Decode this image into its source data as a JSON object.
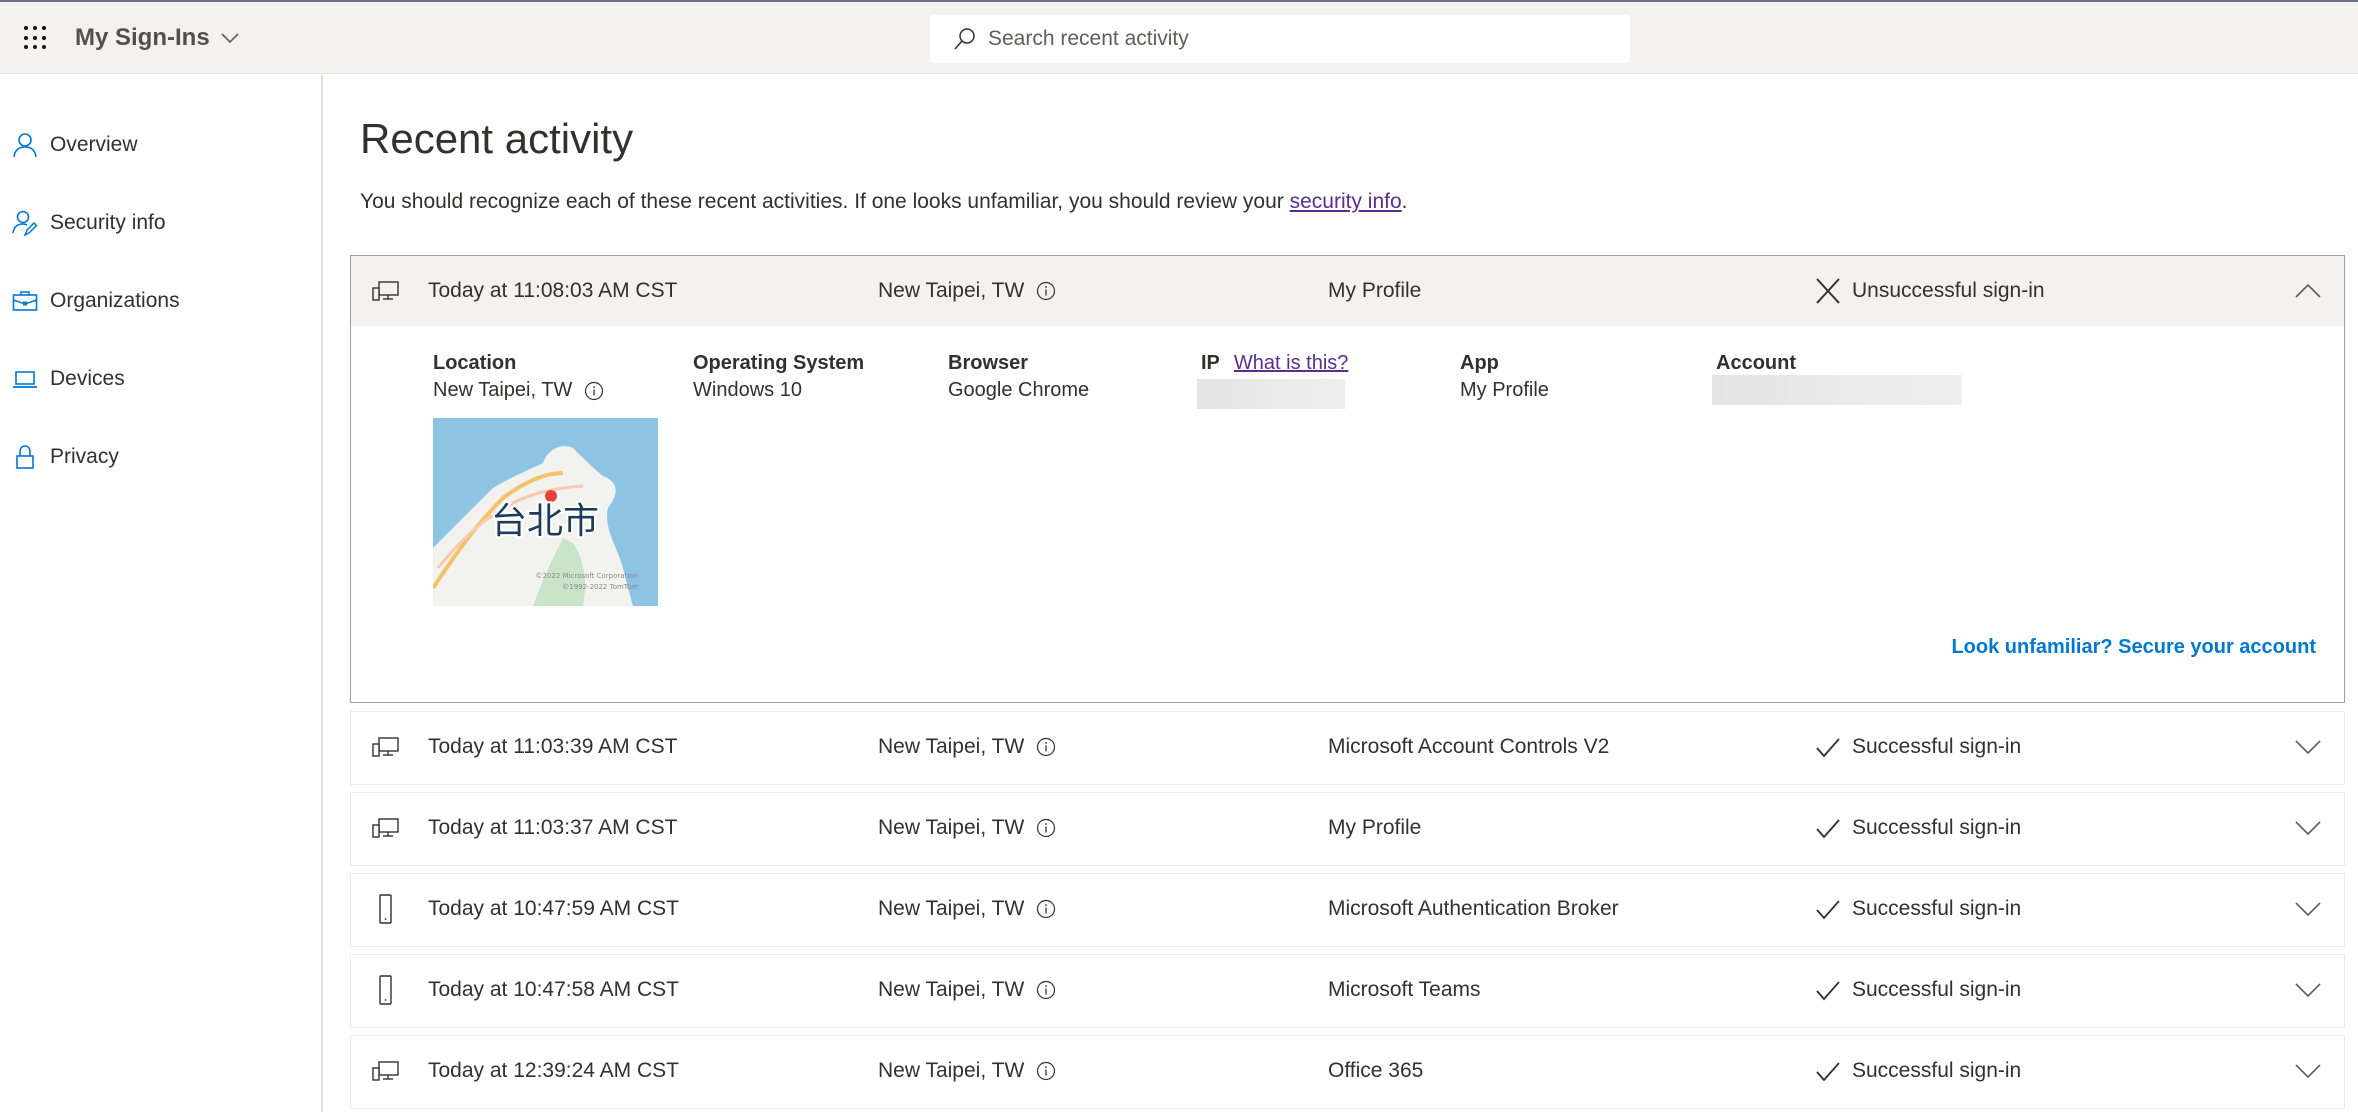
{
  "header": {
    "app_title": "My Sign-Ins",
    "search_placeholder": "Search recent activity",
    "icons": {
      "launcher": "waffle-icon",
      "title_menu": "chevron-down-icon",
      "search": "search-icon"
    }
  },
  "sidebar": {
    "items": [
      {
        "label": "Overview",
        "icon": "person-icon"
      },
      {
        "label": "Security info",
        "icon": "person-edit-icon"
      },
      {
        "label": "Organizations",
        "icon": "briefcase-icon"
      },
      {
        "label": "Devices",
        "icon": "laptop-icon"
      },
      {
        "label": "Privacy",
        "icon": "lock-icon"
      }
    ],
    "accent_color": "#0078d4"
  },
  "main": {
    "title": "Recent activity",
    "subtitle_text": "You should recognize each of these recent activities. If one looks unfamiliar, you should review your ",
    "subtitle_link": "security info",
    "subtitle_end": ".",
    "expanded": {
      "time": "Today at 11:08:03 AM CST",
      "location": "New Taipei, TW",
      "app": "My Profile",
      "status": "Unsuccessful sign-in",
      "device_icon": "desktop-and-phone-icon",
      "details": {
        "location_label": "Location",
        "location_value": "New Taipei, TW",
        "os_label": "Operating System",
        "os_value": "Windows 10",
        "browser_label": "Browser",
        "browser_value": "Google Chrome",
        "ip_label": "IP",
        "ip_help_link": "What is this?",
        "app_label": "App",
        "app_value": "My Profile",
        "account_label": "Account",
        "map_label": "台北市",
        "map_copyright_1": "©2022 Microsoft Corporation",
        "map_copyright_2": "©1992-2022 TomTom"
      },
      "secure_link": "Look unfamiliar? Secure your account"
    },
    "rows": [
      {
        "time": "Today at 11:03:39 AM CST",
        "location": "New Taipei, TW",
        "app": "Microsoft Account Controls V2",
        "status": "Successful sign-in",
        "device": "desktop"
      },
      {
        "time": "Today at 11:03:37 AM CST",
        "location": "New Taipei, TW",
        "app": "My Profile",
        "status": "Successful sign-in",
        "device": "desktop"
      },
      {
        "time": "Today at 10:47:59 AM CST",
        "location": "New Taipei, TW",
        "app": "Microsoft Authentication Broker",
        "status": "Successful sign-in",
        "device": "phone"
      },
      {
        "time": "Today at 10:47:58 AM CST",
        "location": "New Taipei, TW",
        "app": "Microsoft Teams",
        "status": "Successful sign-in",
        "device": "phone"
      },
      {
        "time": "Today at 12:39:24 AM CST",
        "location": "New Taipei, TW",
        "app": "Office 365",
        "status": "Successful sign-in",
        "device": "desktop"
      }
    ],
    "link_color": "#5c2d91",
    "secure_color": "#0078d4"
  }
}
